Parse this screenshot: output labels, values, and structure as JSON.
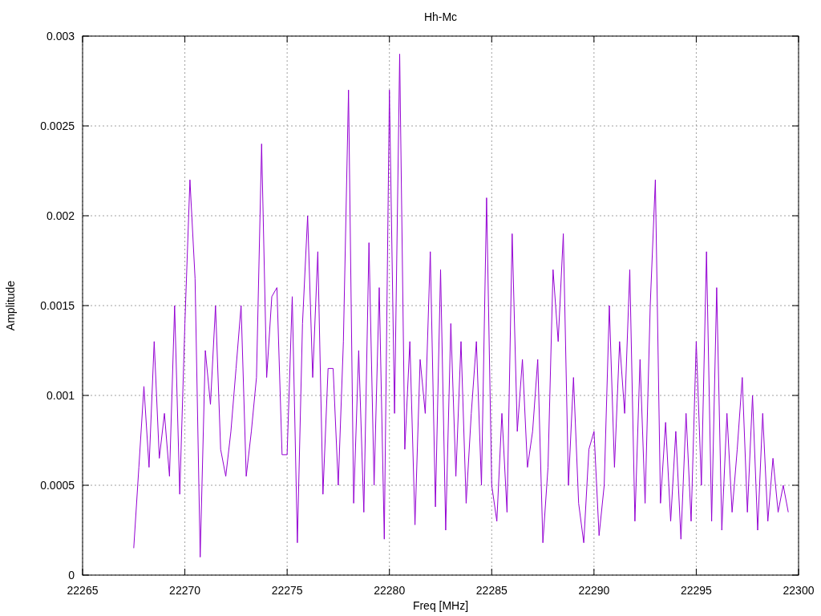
{
  "chart_data": {
    "type": "line",
    "title": "Hh-Mc",
    "xlabel": "Freq [MHz]",
    "ylabel": "Amplitude",
    "xlim": [
      22265,
      22300
    ],
    "ylim": [
      0,
      0.003
    ],
    "xticks": [
      22265,
      22270,
      22275,
      22280,
      22285,
      22290,
      22295,
      22300
    ],
    "yticks": [
      0,
      0.0005,
      0.001,
      0.0015,
      0.002,
      0.0025,
      0.003
    ],
    "grid": true,
    "x": [
      22267.5,
      22267.75,
      22268,
      22268.25,
      22268.5,
      22268.75,
      22269,
      22269.25,
      22269.5,
      22269.75,
      22270,
      22270.25,
      22270.5,
      22270.75,
      22271,
      22271.25,
      22271.5,
      22271.75,
      22272,
      22272.25,
      22272.5,
      22272.75,
      22273,
      22273.25,
      22273.5,
      22273.75,
      22274,
      22274.25,
      22274.5,
      22274.75,
      22275,
      22275.25,
      22275.5,
      22275.75,
      22276,
      22276.25,
      22276.5,
      22276.75,
      22277,
      22277.25,
      22277.5,
      22277.75,
      22278,
      22278.25,
      22278.5,
      22278.75,
      22279,
      22279.25,
      22279.5,
      22279.75,
      22280,
      22280.25,
      22280.5,
      22280.75,
      22281,
      22281.25,
      22281.5,
      22281.75,
      22282,
      22282.25,
      22282.5,
      22282.75,
      22283,
      22283.25,
      22283.5,
      22283.75,
      22284,
      22284.25,
      22284.5,
      22284.75,
      22285,
      22285.25,
      22285.5,
      22285.75,
      22286,
      22286.25,
      22286.5,
      22286.75,
      22287,
      22287.25,
      22287.5,
      22287.75,
      22288,
      22288.25,
      22288.5,
      22288.75,
      22289,
      22289.25,
      22289.5,
      22289.75,
      22290,
      22290.25,
      22290.5,
      22290.75,
      22291,
      22291.25,
      22291.5,
      22291.75,
      22292,
      22292.25,
      22292.5,
      22292.75,
      22293,
      22293.25,
      22293.5,
      22293.75,
      22294,
      22294.25,
      22294.5,
      22294.75,
      22295,
      22295.25,
      22295.5,
      22295.75,
      22296,
      22296.25,
      22296.5,
      22296.75,
      22297,
      22297.25,
      22297.5,
      22297.75,
      22298,
      22298.25,
      22298.5,
      22298.75,
      22299,
      22299.25,
      22299.5
    ],
    "series": [
      {
        "color": "#9400d3",
        "values": [
          0.00015,
          0.0006,
          0.00105,
          0.0006,
          0.0013,
          0.00065,
          0.0009,
          0.00055,
          0.0015,
          0.00045,
          0.0014,
          0.0022,
          0.00165,
          0.0001,
          0.00125,
          0.00095,
          0.0015,
          0.0007,
          0.00055,
          0.0008,
          0.00115,
          0.0015,
          0.00055,
          0.0008,
          0.0011,
          0.0024,
          0.0011,
          0.00155,
          0.0016,
          0.00067,
          0.00067,
          0.00155,
          0.00018,
          0.0014,
          0.002,
          0.0011,
          0.0018,
          0.00045,
          0.00115,
          0.00115,
          0.0005,
          0.0013,
          0.0027,
          0.0004,
          0.00125,
          0.00035,
          0.00185,
          0.0005,
          0.0016,
          0.0002,
          0.0027,
          0.0009,
          0.0029,
          0.0007,
          0.0013,
          0.00028,
          0.0012,
          0.0009,
          0.0018,
          0.00038,
          0.0017,
          0.00025,
          0.0014,
          0.00055,
          0.0013,
          0.0004,
          0.0009,
          0.0013,
          0.0005,
          0.0021,
          0.0005,
          0.0003,
          0.0009,
          0.00035,
          0.0019,
          0.0008,
          0.0012,
          0.0006,
          0.0008,
          0.0012,
          0.00018,
          0.0006,
          0.0017,
          0.0013,
          0.0019,
          0.0005,
          0.0011,
          0.0004,
          0.00018,
          0.0007,
          0.0008,
          0.00022,
          0.0005,
          0.0015,
          0.0006,
          0.0013,
          0.0009,
          0.0017,
          0.0003,
          0.0012,
          0.0004,
          0.0015,
          0.0022,
          0.0004,
          0.00085,
          0.0003,
          0.0008,
          0.0002,
          0.0009,
          0.0003,
          0.0013,
          0.0005,
          0.0018,
          0.0003,
          0.0016,
          0.00025,
          0.0009,
          0.00035,
          0.0007,
          0.0011,
          0.00035,
          0.001,
          0.00025,
          0.0009,
          0.0003,
          0.00065,
          0.00035,
          0.0005,
          0.00035
        ]
      }
    ]
  }
}
